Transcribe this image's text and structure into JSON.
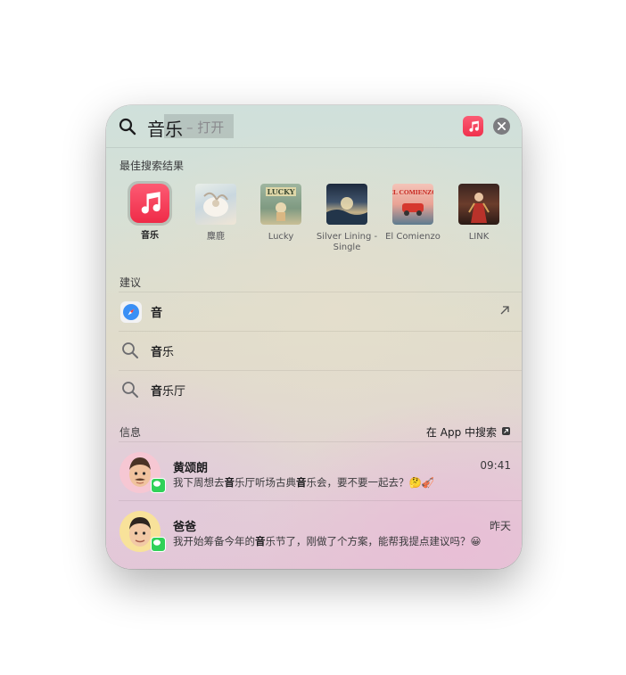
{
  "search": {
    "query": "音乐",
    "hint": "– 打开",
    "app_icon": "music-note-icon",
    "clear_icon": "close-icon"
  },
  "top_hits": {
    "label": "最佳搜索结果",
    "items": [
      {
        "name": "音乐",
        "icon": "music-app-icon"
      },
      {
        "name": "麋鹿",
        "icon": "album-art"
      },
      {
        "name": "Lucky",
        "icon": "album-art"
      },
      {
        "name": "Silver Lining - Single",
        "icon": "album-art"
      },
      {
        "name": "El Comienzo",
        "icon": "album-art"
      },
      {
        "name": "LINK",
        "icon": "album-art"
      }
    ]
  },
  "suggestions": {
    "label": "建议",
    "items": [
      {
        "bold": "音",
        "rest": "",
        "icon": "safari-compass-icon"
      },
      {
        "bold": "音",
        "rest": "乐",
        "icon": "search-icon"
      },
      {
        "bold": "音",
        "rest": "乐厅",
        "icon": "search-icon"
      }
    ]
  },
  "messages": {
    "label": "信息",
    "search_in_app": "在 App 中搜索",
    "items": [
      {
        "sender": "黄颂朗",
        "time": "09:41",
        "preview": [
          "我下周想去",
          "音",
          "乐厅听场古典",
          "音",
          "乐会，要不要一起去？🤔🎻"
        ]
      },
      {
        "sender": "爸爸",
        "time": "昨天",
        "preview": [
          "我开始筹备今年的",
          "音",
          "乐节了，刚做了个方案，能帮我提点建议吗？😀"
        ]
      }
    ]
  },
  "colors": {
    "accent": "#fa2d48",
    "message_green": "#30d158"
  }
}
